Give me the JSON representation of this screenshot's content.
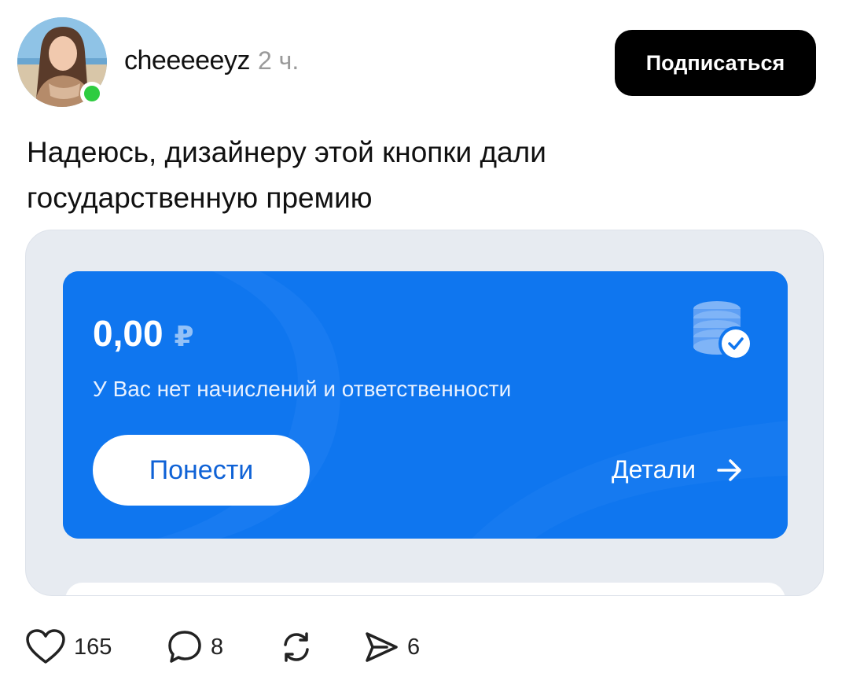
{
  "header": {
    "username": "cheeeeeyz",
    "time": "2 ч.",
    "subscribe_label": "Подписаться"
  },
  "post": {
    "text_line1": "Надеюсь, дизайнеру этой кнопки дали",
    "text_line2": "государственную премию"
  },
  "card": {
    "balance": "0,00",
    "currency": "₽",
    "subtitle": "У Вас нет начислений и ответственности",
    "primary_button": "Понести",
    "details_link": "Детали"
  },
  "actions": {
    "likes": "165",
    "comments": "8",
    "shares": "6"
  },
  "colors": {
    "card_blue": "#0f76ef",
    "online": "#2ecc40",
    "button_black": "#000000"
  }
}
